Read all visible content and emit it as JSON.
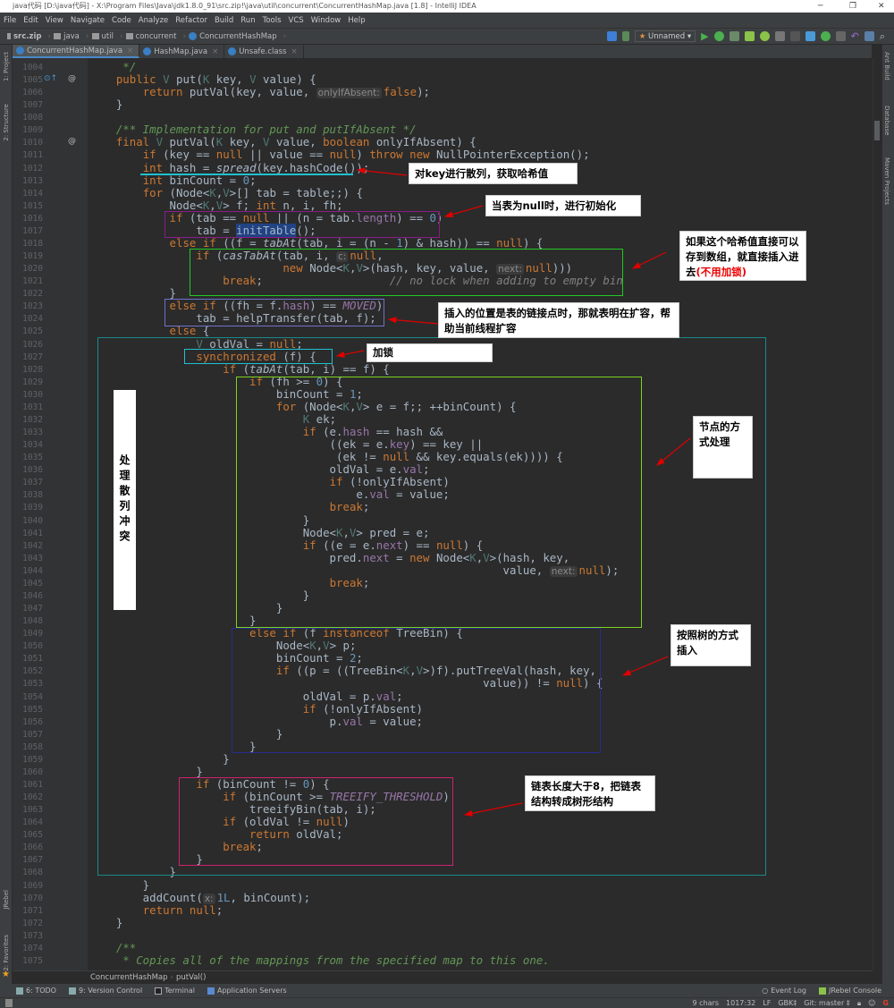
{
  "window": {
    "title": "java代码 [D:\\java代码] - X:\\Program Files\\Java\\jdk1.8.0_91\\src.zip!\\java\\util\\concurrent\\ConcurrentHashMap.java [1.8] - IntelliJ IDEA",
    "minimize": "─",
    "maximize": "❐",
    "close": "✕"
  },
  "menu": [
    "File",
    "Edit",
    "View",
    "Navigate",
    "Code",
    "Analyze",
    "Refactor",
    "Build",
    "Run",
    "Tools",
    "VCS",
    "Window",
    "Help"
  ],
  "breadcrumb": [
    "src.zip",
    "java",
    "util",
    "concurrent",
    "ConcurrentHashMap"
  ],
  "toolbar": {
    "run_config": "Unnamed",
    "run_config_arrow": "▾"
  },
  "tabs": [
    {
      "label": "ConcurrentHashMap.java",
      "active": true
    },
    {
      "label": "HashMap.java"
    },
    {
      "label": "Unsafe.class"
    }
  ],
  "left_tools": [
    "1: Project",
    "2: Structure",
    "JRebel",
    "2: Favorites"
  ],
  "right_tools": [
    "Ant Build",
    "Database",
    "Maven Projects"
  ],
  "code": [
    {
      "n": "1004",
      "t": "     */",
      "doc": true
    },
    {
      "n": "1005",
      "t": "    public V put(K key, V value) {"
    },
    {
      "n": "1006",
      "t": "        return putVal(key, value, «onlyIfAbsent:»false);"
    },
    {
      "n": "1007",
      "t": "    }"
    },
    {
      "n": "1008",
      "t": ""
    },
    {
      "n": "1009",
      "t": "    /** Implementation for put and putIfAbsent */",
      "doc": true
    },
    {
      "n": "1010",
      "t": "    final V putVal(K key, V value, boolean onlyIfAbsent) {"
    },
    {
      "n": "1011",
      "t": "        if (key == null || value == null) throw new NullPointerException();"
    },
    {
      "n": "1012",
      "t": "        int hash = spread(key.hashCode());"
    },
    {
      "n": "1013",
      "t": "        int binCount = 0;"
    },
    {
      "n": "1014",
      "t": "        for (Node<K,V>[] tab = table;;) {"
    },
    {
      "n": "1015",
      "t": "            Node<K,V> f; int n, i, fh;"
    },
    {
      "n": "1016",
      "t": "            if (tab == null || (n = tab.length) == 0)"
    },
    {
      "n": "1017",
      "t": "                tab = initTable();"
    },
    {
      "n": "1018",
      "t": "            else if ((f = tabAt(tab, i = (n - 1) & hash)) == null) {"
    },
    {
      "n": "1019",
      "t": "                if (casTabAt(tab, i, «c:»null,"
    },
    {
      "n": "1020",
      "t": "                             new Node<K,V>(hash, key, value, «next:»null)))"
    },
    {
      "n": "1021",
      "t": "                    break;                   // no lock when adding to empty bin"
    },
    {
      "n": "1022",
      "t": "            }"
    },
    {
      "n": "1023",
      "t": "            else if ((fh = f.hash) == MOVED)"
    },
    {
      "n": "1024",
      "t": "                tab = helpTransfer(tab, f);"
    },
    {
      "n": "1025",
      "t": "            else {"
    },
    {
      "n": "1026",
      "t": "                V oldVal = null;"
    },
    {
      "n": "1027",
      "t": "                synchronized (f) {"
    },
    {
      "n": "1028",
      "t": "                    if (tabAt(tab, i) == f) {"
    },
    {
      "n": "1029",
      "t": "                        if (fh >= 0) {"
    },
    {
      "n": "1030",
      "t": "                            binCount = 1;"
    },
    {
      "n": "1031",
      "t": "                            for (Node<K,V> e = f;; ++binCount) {"
    },
    {
      "n": "1032",
      "t": "                                K ek;"
    },
    {
      "n": "1033",
      "t": "                                if (e.hash == hash &&"
    },
    {
      "n": "1034",
      "t": "                                    ((ek = e.key) == key ||"
    },
    {
      "n": "1035",
      "t": "                                     (ek != null && key.equals(ek)))) {"
    },
    {
      "n": "1036",
      "t": "                                    oldVal = e.val;"
    },
    {
      "n": "1037",
      "t": "                                    if (!onlyIfAbsent)"
    },
    {
      "n": "1038",
      "t": "                                        e.val = value;"
    },
    {
      "n": "1039",
      "t": "                                    break;"
    },
    {
      "n": "1040",
      "t": "                                }"
    },
    {
      "n": "1041",
      "t": "                                Node<K,V> pred = e;"
    },
    {
      "n": "1042",
      "t": "                                if ((e = e.next) == null) {"
    },
    {
      "n": "1043",
      "t": "                                    pred.next = new Node<K,V>(hash, key,"
    },
    {
      "n": "1044",
      "t": "                                                              value, «next:»null);"
    },
    {
      "n": "1045",
      "t": "                                    break;"
    },
    {
      "n": "1046",
      "t": "                                }"
    },
    {
      "n": "1047",
      "t": "                            }"
    },
    {
      "n": "1048",
      "t": "                        }"
    },
    {
      "n": "1049",
      "t": "                        else if (f instanceof TreeBin) {"
    },
    {
      "n": "1050",
      "t": "                            Node<K,V> p;"
    },
    {
      "n": "1051",
      "t": "                            binCount = 2;"
    },
    {
      "n": "1052",
      "t": "                            if ((p = ((TreeBin<K,V>)f).putTreeVal(hash, key,"
    },
    {
      "n": "1053",
      "t": "                                                           value)) != null) {"
    },
    {
      "n": "1054",
      "t": "                                oldVal = p.val;"
    },
    {
      "n": "1055",
      "t": "                                if (!onlyIfAbsent)"
    },
    {
      "n": "1056",
      "t": "                                    p.val = value;"
    },
    {
      "n": "1057",
      "t": "                            }"
    },
    {
      "n": "1058",
      "t": "                        }"
    },
    {
      "n": "1059",
      "t": "                    }"
    },
    {
      "n": "1060",
      "t": "                }"
    },
    {
      "n": "1061",
      "t": "                if (binCount != 0) {"
    },
    {
      "n": "1062",
      "t": "                    if (binCount >= TREEIFY_THRESHOLD)"
    },
    {
      "n": "1063",
      "t": "                        treeifyBin(tab, i);"
    },
    {
      "n": "1064",
      "t": "                    if (oldVal != null)"
    },
    {
      "n": "1065",
      "t": "                        return oldVal;"
    },
    {
      "n": "1066",
      "t": "                    break;"
    },
    {
      "n": "1067",
      "t": "                }"
    },
    {
      "n": "1068",
      "t": "            }"
    },
    {
      "n": "1069",
      "t": "        }"
    },
    {
      "n": "1070",
      "t": "        addCount(«x:»1L, binCount);"
    },
    {
      "n": "1071",
      "t": "        return null;"
    },
    {
      "n": "1072",
      "t": "    }"
    },
    {
      "n": "1073",
      "t": ""
    },
    {
      "n": "1074",
      "t": "    /**",
      "doc": true
    },
    {
      "n": "1075",
      "t": "     * Copies all of the mappings from the specified map to this one.",
      "doc": true
    }
  ],
  "annotations": {
    "hash": "对key进行散列，获取哈希值",
    "init": "当表为null时，进行初始化",
    "cas_main": "如果这个哈希值直接可以存到数组，就直接插入进去",
    "cas_red": "(不用加锁)",
    "moved": "插入的位置是表的链接点时，那就表明在扩容，帮助当前线程扩容",
    "lock": "加锁",
    "conflict": "处理散列冲突",
    "list": "节点的方式处理",
    "tree": "按照树的方式插入",
    "treeify": "链表长度大于8，把链表结构转成树形结构"
  },
  "bottom_breadcrumb": [
    "ConcurrentHashMap",
    "putVal()"
  ],
  "tool_windows": [
    "6: TODO",
    "9: Version Control",
    "Terminal",
    "Application Servers"
  ],
  "tool_windows_right": [
    "Event Log",
    "JRebel Console"
  ],
  "status": {
    "selection": "9 chars",
    "position": "1017:32",
    "line_sep": "LF",
    "encoding": "GBK‡",
    "vcs": "Git: master ‡"
  },
  "colors": {
    "editor_bg": "#2b2b2b",
    "keyword": "#cc7832",
    "number": "#6897bb",
    "doc_comment": "#629755",
    "arrow": "#e00000"
  }
}
